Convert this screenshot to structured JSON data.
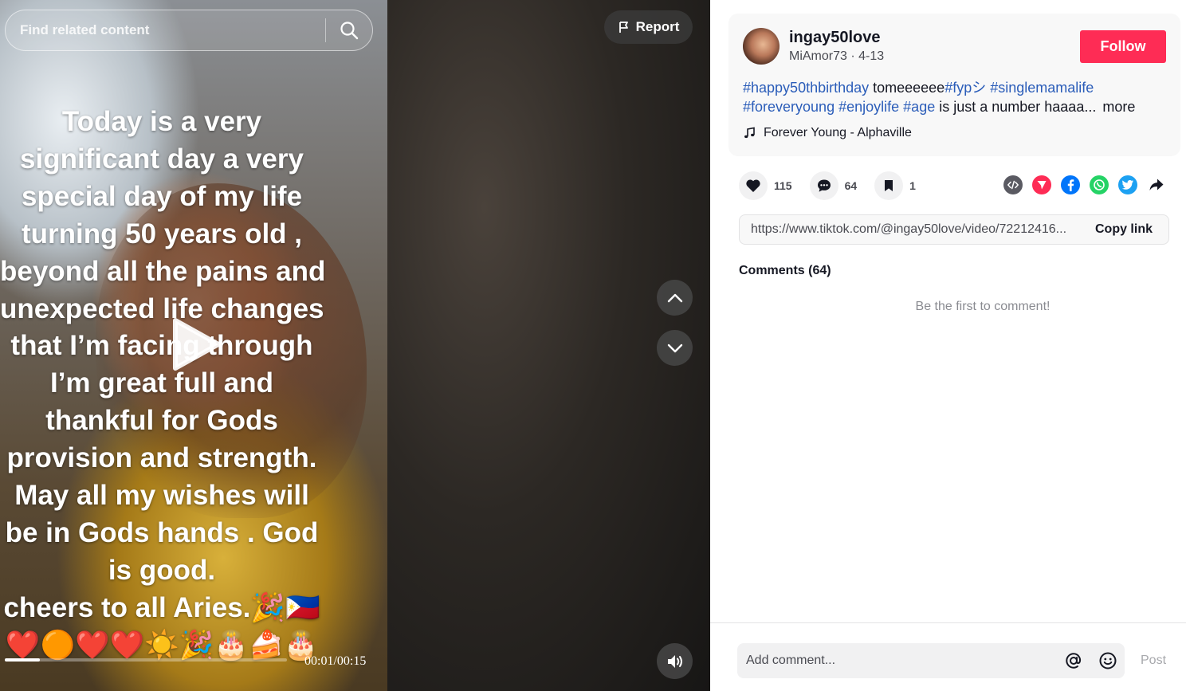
{
  "search": {
    "placeholder": "Find related content"
  },
  "video": {
    "overlay_lines": [
      "Today is a very",
      "significant day a very",
      "special day of my life",
      "turning 50 years old ,",
      "beyond all the pains and",
      "unexpected life changes",
      "that I’m facing through",
      "I’m great full and",
      "thankful for Gods",
      "provision and strength.",
      "May all my wishes will",
      "be in Gods hands . God",
      "is good.",
      "cheers to all Aries.🎉🇵🇭",
      "❤️🟠❤️❤️☀️🎉🎂🍰🎂"
    ],
    "time": "00:01/00:15",
    "progress_fraction": 0.125,
    "report_label": "Report"
  },
  "author": {
    "username": "ingay50love",
    "nickname": "MiAmor73",
    "date": "4-13",
    "follow_label": "Follow"
  },
  "caption": {
    "parts": [
      {
        "text": "#happy50thbirthday",
        "tag": true
      },
      {
        "text": " tomeeeeee",
        "tag": false
      },
      {
        "text": "#fypシ",
        "tag": true
      },
      {
        "text": " ",
        "tag": false
      },
      {
        "text": "#singlemamalife",
        "tag": true
      },
      {
        "text": " ",
        "tag": false
      },
      {
        "text": "#foreveryoung",
        "tag": true
      },
      {
        "text": " ",
        "tag": false
      },
      {
        "text": "#enjoylife",
        "tag": true
      },
      {
        "text": " ",
        "tag": false
      },
      {
        "text": "#age",
        "tag": true
      },
      {
        "text": " is just a number haaaa...",
        "tag": false
      }
    ],
    "more_label": "more"
  },
  "music": {
    "title": "Forever Young - Alphaville"
  },
  "stats": {
    "likes": "115",
    "comments": "64",
    "saves": "1"
  },
  "share": {
    "icons": [
      "embed-icon",
      "send-icon",
      "facebook-icon",
      "whatsapp-icon",
      "twitter-icon",
      "share-arrow-icon"
    ],
    "colors": {
      "embed": "#5a5a62",
      "send": "#fe2c55",
      "facebook": "#0075fa",
      "whatsapp": "#25d366",
      "twitter": "#1da1f2"
    }
  },
  "link": {
    "url": "https://www.tiktok.com/@ingay50love/video/72212416...",
    "copy_label": "Copy link"
  },
  "comments": {
    "title": "Comments (64)",
    "empty_message": "Be the first to comment!"
  },
  "composer": {
    "placeholder": "Add comment...",
    "post_label": "Post"
  },
  "colors": {
    "accent": "#fe2c55",
    "hashtag": "#2b5db9"
  }
}
